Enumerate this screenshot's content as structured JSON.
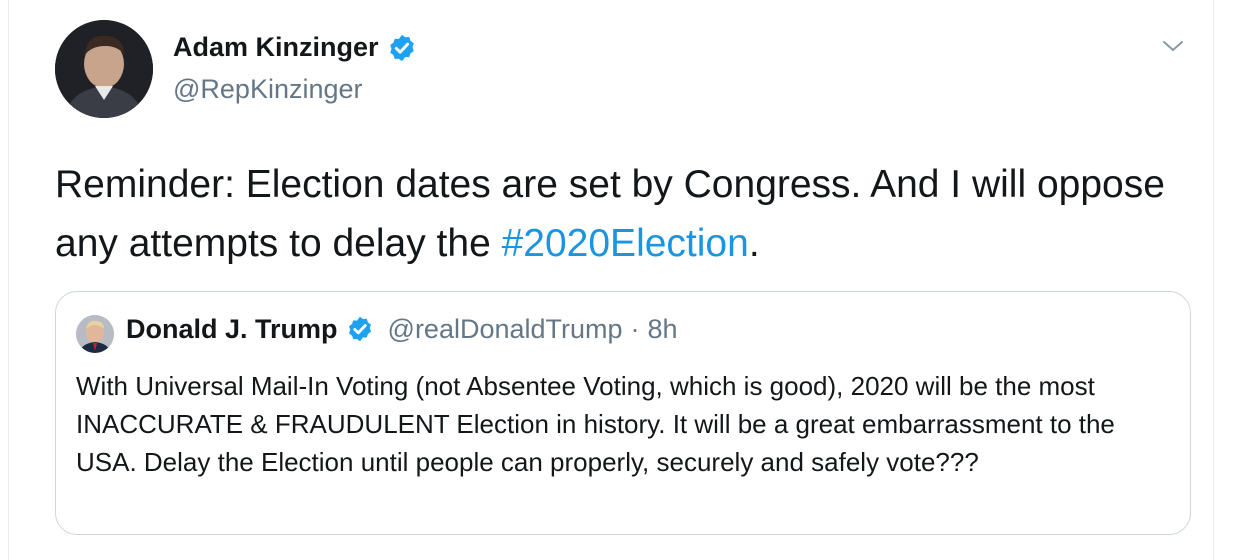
{
  "tweet": {
    "author": {
      "name": "Adam Kinzinger",
      "handle": "@RepKinzinger",
      "verified": true
    },
    "text_before_hashtag": "Reminder: Election dates are set by Congress. And I will oppose any attempts to delay the ",
    "hashtag": "#2020Election",
    "text_after_hashtag": ".",
    "menu_icon": "chevron-down-icon"
  },
  "quoted_tweet": {
    "author": {
      "name": "Donald J. Trump",
      "handle": "@realDonaldTrump",
      "verified": true
    },
    "separator": "·",
    "time": "8h",
    "text": "With Universal Mail-In Voting (not Absentee Voting, which is good), 2020 will be the most INACCURATE & FRAUDULENT Election in history. It will be a great embarrassment to the USA. Delay the Election until people can properly, securely and safely vote???"
  },
  "colors": {
    "text": "#14171a",
    "secondary": "#657786",
    "link": "#1b95e0",
    "verified": "#1da1f2",
    "border": "#ccd6dd"
  }
}
